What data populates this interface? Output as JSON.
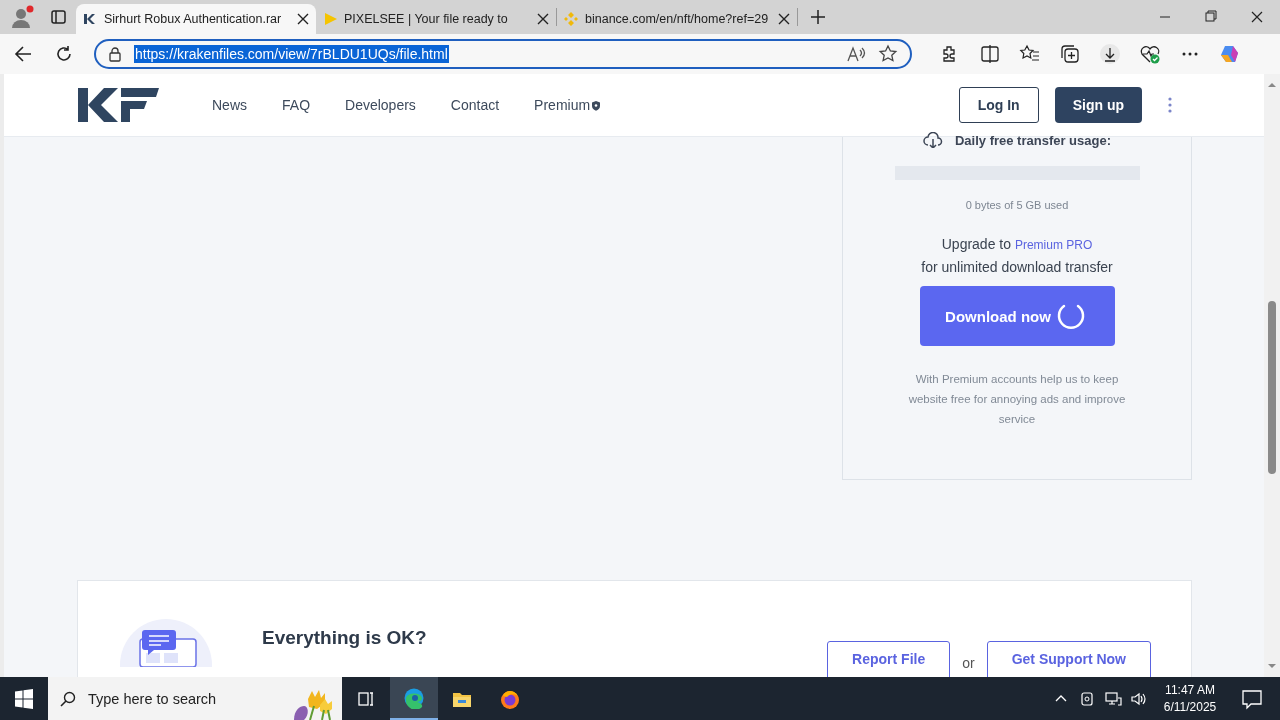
{
  "browser": {
    "tabs": [
      {
        "title": "Sirhurt Robux Authentication.rar",
        "selected": true
      },
      {
        "title": "PIXELSEE | Your file ready to",
        "selected": false
      },
      {
        "title": "binance.com/en/nft/home?ref=29",
        "selected": false
      }
    ],
    "url": "https://krakenfiles.com/view/7rBLDU1UQs/file.html"
  },
  "site": {
    "nav": [
      "News",
      "FAQ",
      "Developers",
      "Contact",
      "Premium"
    ],
    "login": "Log In",
    "signup": "Sign up"
  },
  "download_panel": {
    "usage_label": "Daily free transfer usage:",
    "usage": {
      "level": 0
    },
    "usage_text": "0 bytes of 5 GB used",
    "upgrade_prefix": "Upgrade to",
    "upgrade_link": "Premium PRO",
    "upgrade_suffix": "for unlimited download transfer",
    "button": "Download now",
    "loading": true,
    "note": "With Premium accounts help us to keep website free for annoying ads and improve service"
  },
  "ok_card": {
    "title": "Everything is OK?",
    "report_button": "Report File",
    "separator": "or",
    "support_button": "Get Support Now"
  },
  "taskbar": {
    "search_placeholder": "Type here to search",
    "time": "11:47 AM",
    "date": "6/11/2025"
  }
}
